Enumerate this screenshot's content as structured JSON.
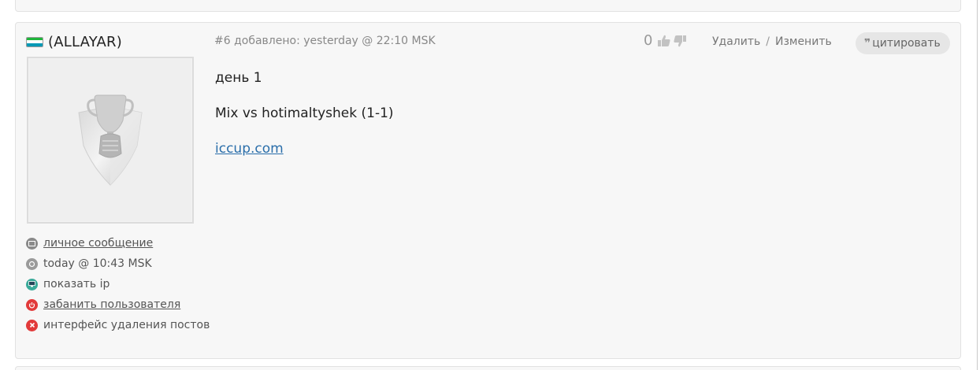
{
  "post": {
    "author": {
      "name": "(ALLAYAR)",
      "flag_colors": [
        "#1eb53a",
        "#ffffff",
        "#0099b5"
      ]
    },
    "meta": {
      "number": "#6",
      "added_label": "добавлено:",
      "timestamp": "yesterday @ 22:10 MSK"
    },
    "rating": {
      "value": "0",
      "like_icon": "thumbs-up-icon",
      "dislike_icon": "thumbs-down-icon"
    },
    "actions": {
      "delete_label": "Удалить",
      "separator": "/",
      "edit_label": "Изменить",
      "quote_label": "цитировать",
      "quote_icon": "quote-icon"
    },
    "content": {
      "lines": [
        "день 1",
        "Mix vs hotimaltyshek (1-1)"
      ],
      "link_text": "iccup.com"
    },
    "sidebar": {
      "items": [
        {
          "label": "личное сообщение",
          "icon": "message-icon",
          "color": "#8a8a8a",
          "link": true
        },
        {
          "label": "today @ 10:43 MSK",
          "icon": "clock-icon",
          "color": "#9a9a9a",
          "link": false
        },
        {
          "label": "показать ip",
          "icon": "monitor-icon",
          "color": "#3aaa9a",
          "link": false
        },
        {
          "label": "забанить пользователя",
          "icon": "power-icon",
          "color": "#e23a3a",
          "link": true
        },
        {
          "label": "интерфейс удаления постов",
          "icon": "delete-icon",
          "color": "#e23a3a",
          "link": false
        }
      ]
    }
  }
}
